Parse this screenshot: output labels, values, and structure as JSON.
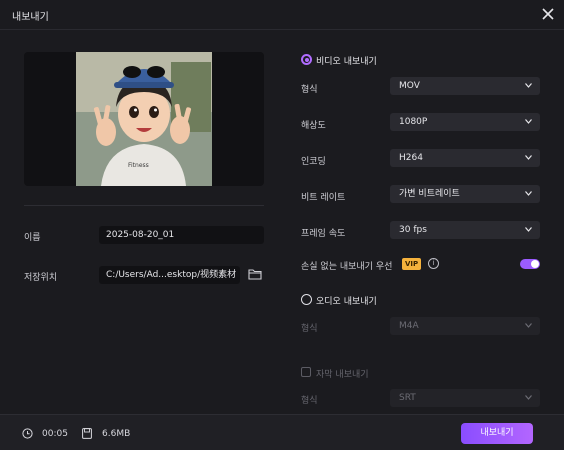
{
  "window": {
    "title": "내보내기"
  },
  "details": {
    "name_label": "이름",
    "name_value": "2025-08-20_01",
    "location_label": "저장위치",
    "location_value": "C:/Users/Ad...esktop/视频素材"
  },
  "video": {
    "section_label": "비디오 내보내기",
    "selected": true,
    "rows": [
      {
        "label": "형식",
        "value": "MOV"
      },
      {
        "label": "해상도",
        "value": "1080P"
      },
      {
        "label": "인코딩",
        "value": "H264"
      },
      {
        "label": "비트 레이트",
        "value": "가변 비트레이트"
      },
      {
        "label": "프레임 속도",
        "value": "30  fps"
      }
    ],
    "lossless_label": "손실 없는 내보내기 우선",
    "vip_badge": "VIP",
    "lossless_enabled": true
  },
  "audio": {
    "section_label": "오디오 내보내기",
    "selected": false,
    "format_label": "형식",
    "format_value": "M4A"
  },
  "subtitle": {
    "checkbox_label": "자막 내보내기",
    "checked": false,
    "format_label": "형식",
    "format_value": "SRT"
  },
  "footer": {
    "duration": "00:05",
    "size": "6.6MB",
    "export_label": "내보내기"
  },
  "colors": {
    "accent": "#9b5cff",
    "vip": "#f5b23c",
    "background": "#1b1b1f"
  }
}
